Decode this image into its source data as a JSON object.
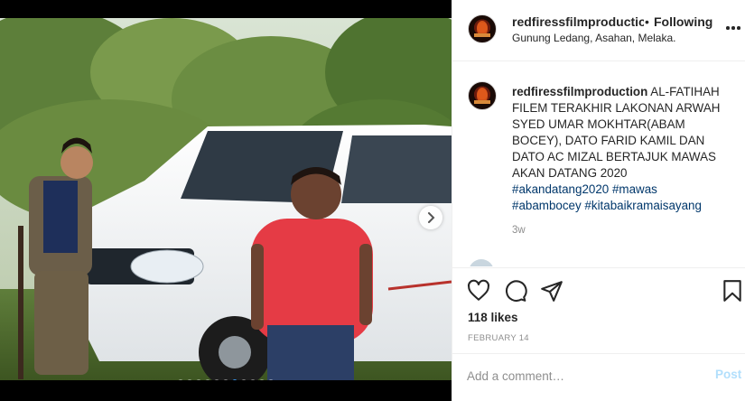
{
  "post": {
    "username": "redfiressfilmproduction",
    "separator": "•",
    "follow_status": "Following",
    "location": "Gunung Ledang, Asahan, Melaka.",
    "caption": {
      "username": "redfiressfilmproduction",
      "text": "AL-FATIHAH FILEM TERAKHIR LAKONAN ARWAH SYED UMAR MOKHTAR(ABAM BOCEY), DATO FARID KAMIL DAN DATO AC MIZAL BERTAJUK MAWAS AKAN DATANG 2020",
      "hashtags": [
        "#akandatang2020",
        "#mawas",
        "#abambocey",
        "#kitabaikramaisayang"
      ],
      "time_ago": "3w"
    },
    "likes": "118 likes",
    "date": "FEBRUARY 14",
    "comment_placeholder": "Add a comment…",
    "post_label": "Post"
  },
  "media": {
    "carousel_total": 11,
    "carousel_active_index": 6,
    "next_icon": "chevron-right-icon"
  },
  "colors": {
    "accent_blue": "#3897f0",
    "link_blue": "#00376b",
    "post_disabled": "#b2dffc",
    "muted": "#8e8e8e"
  },
  "icons": [
    "heart-icon",
    "comment-icon",
    "share-icon",
    "bookmark-icon",
    "more-options-icon"
  ]
}
